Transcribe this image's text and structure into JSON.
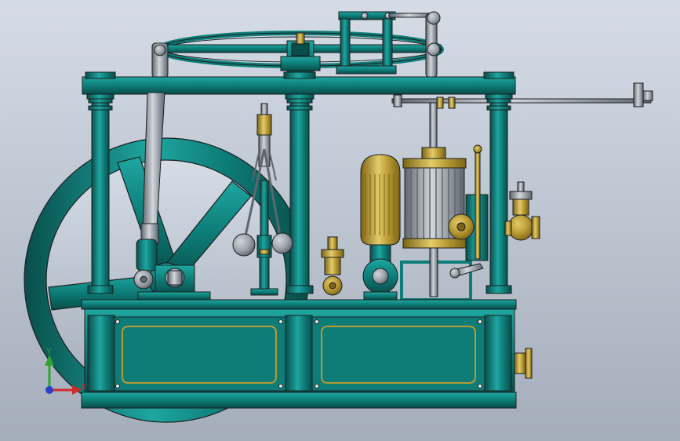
{
  "viewport": {
    "background_top": "#D5DCE6",
    "background_bottom": "#A4ADBA"
  },
  "model": {
    "colors": {
      "teal": "#0E7D78",
      "teal_dark": "#084E4B",
      "teal_light": "#1FA6A0",
      "brass": "#B89A34",
      "brass_dark": "#7C6416",
      "brass_light": "#E4CC6A",
      "steel": "#9CA3AB",
      "steel_dark": "#5F666D",
      "steel_light": "#D3D7DB",
      "edge": "#1A1F22"
    }
  },
  "triad": {
    "x_label": "X",
    "y_label": "Y",
    "x_color": "#D32A2A",
    "y_color": "#2FA52F",
    "z_color": "#2B3FC8"
  }
}
